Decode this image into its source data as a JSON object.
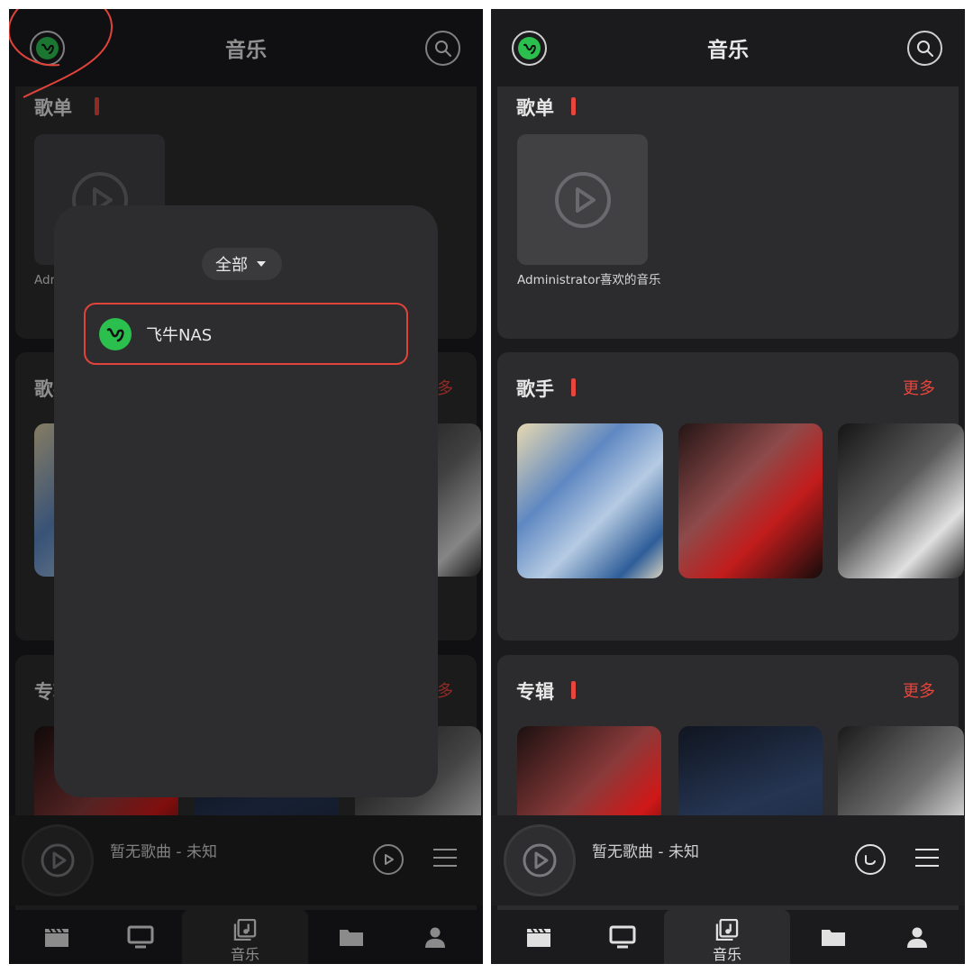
{
  "header": {
    "title": "音乐"
  },
  "playlist_section": {
    "title": "歌单",
    "items": [
      {
        "name": "Administrator喜欢的音乐"
      }
    ]
  },
  "artists_section": {
    "title": "歌手",
    "more_label": "更多"
  },
  "albums_section": {
    "title": "专辑",
    "more_label": "更多"
  },
  "mini_player": {
    "song": "暂无歌曲 - 未知"
  },
  "bottom_nav": [
    {
      "icon": "clapperboard-icon",
      "label": ""
    },
    {
      "icon": "tv-icon",
      "label": ""
    },
    {
      "icon": "music-note-icon",
      "label": "音乐",
      "active": true
    },
    {
      "icon": "folder-icon",
      "label": ""
    },
    {
      "icon": "person-icon",
      "label": ""
    }
  ],
  "server_picker": {
    "filter_label": "全部",
    "servers": [
      {
        "name": "飞牛NAS",
        "selected": true
      }
    ]
  },
  "colors": {
    "accent": "#e8453c",
    "brand": "#2bbf4e",
    "background": "#1b1b1d",
    "card": "#2c2c2e"
  }
}
